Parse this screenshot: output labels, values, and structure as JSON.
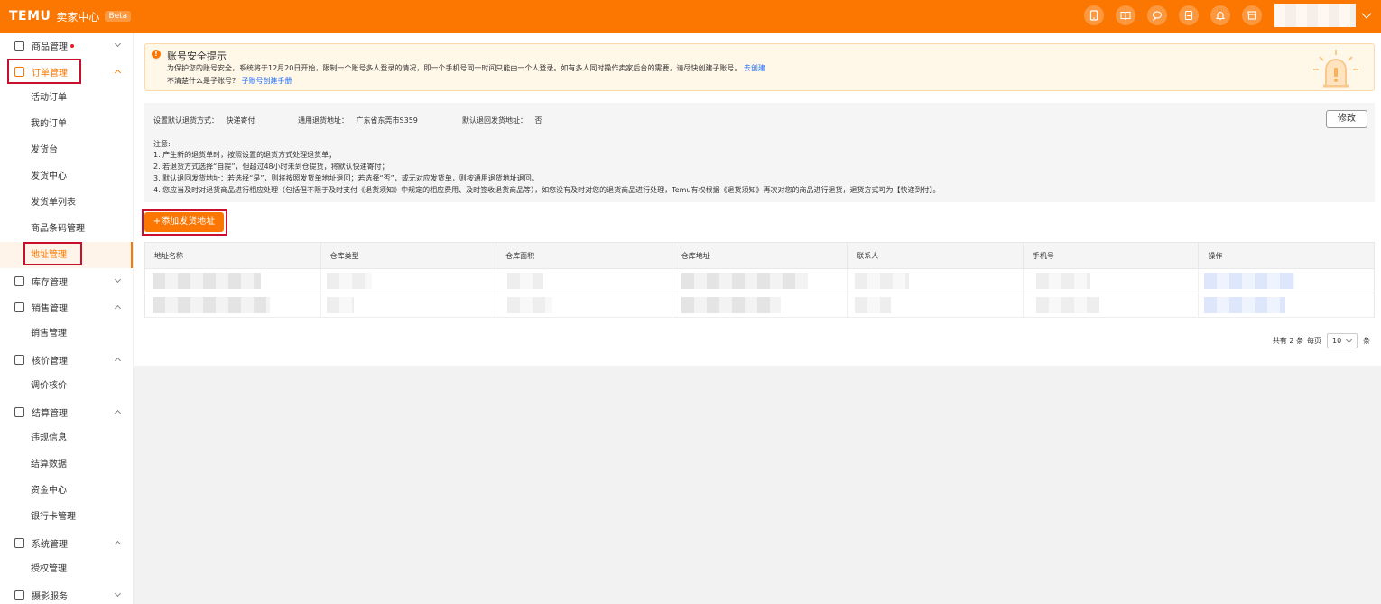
{
  "header": {
    "logo": "TEMU",
    "title": "卖家中心",
    "badge": "Beta",
    "icons": [
      "tablet-icon",
      "book-icon",
      "chat-icon",
      "document-icon",
      "bell-icon",
      "store-icon"
    ]
  },
  "sidebar": {
    "groups": [
      {
        "label": "商品管理",
        "icon": "product-icon",
        "expanded": false,
        "has_dot": true,
        "items": []
      },
      {
        "label": "订单管理",
        "icon": "order-icon",
        "expanded": true,
        "active": true,
        "items": [
          "活动订单",
          "我的订单",
          "发货台",
          "发货中心",
          "发货单列表",
          "商品条码管理",
          "地址管理"
        ]
      },
      {
        "label": "库存管理",
        "icon": "warehouse-icon",
        "expanded": false,
        "items": []
      },
      {
        "label": "销售管理",
        "icon": "sales-chart-icon",
        "expanded": true,
        "items": [
          "销售管理"
        ]
      },
      {
        "label": "核价管理",
        "icon": "price-icon",
        "expanded": true,
        "items": [
          "调价核价"
        ]
      },
      {
        "label": "结算管理",
        "icon": "settlement-icon",
        "expanded": true,
        "items": [
          "违规信息",
          "结算数据",
          "资金中心",
          "银行卡管理"
        ]
      },
      {
        "label": "系统管理",
        "icon": "shield-icon",
        "expanded": true,
        "items": [
          "授权管理"
        ]
      },
      {
        "label": "摄影服务",
        "icon": "camera-icon",
        "expanded": false,
        "items": []
      }
    ],
    "selected_item": "地址管理"
  },
  "alert": {
    "title": "账号安全提示",
    "line1": "为保护您的账号安全，系统将于12月20日开始，限制一个账号多人登录的情况，即一个手机号同一时间只能由一个人登录。如有多人同时操作卖家后台的需要，请尽快创建子账号。",
    "line1_link": "去创建",
    "line2": "不清楚什么是子账号？",
    "line2_link": "子账号创建手册"
  },
  "info": {
    "return_method_label": "设置默认退货方式：",
    "return_method_value": "快递寄付",
    "return_address_label": "通用退货地址：",
    "return_address_value": "广东省东莞市S359",
    "default_ship_label": "默认退回发货地址：",
    "default_ship_value": "否",
    "edit_button": "修改",
    "notes_title": "注意:",
    "notes": [
      "1. 产生新的退货单时，按照设置的退货方式处理退货单；",
      "2. 若退货方式选择“自提”，但超过48小时未到仓提货，将默认快递寄付；",
      "3. 默认退回发货地址：若选择“是”，则将按照发货单地址退回；若选择“否”，或无对应发货单，则按通用退货地址退回。",
      "4. 您应当及时对退货商品进行相应处理（包括但不限于及时支付《退货须知》中规定的相应费用、及时签收退货商品等），如您没有及时对您的退货商品进行处理，Temu有权根据《退货须知》再次对您的商品进行退货，退货方式可为【快递到付】。"
    ]
  },
  "add_button": "+添加发货地址",
  "table": {
    "columns": [
      "地址名称",
      "仓库类型",
      "仓库面积",
      "仓库地址",
      "联系人",
      "手机号",
      "操作"
    ]
  },
  "pager": {
    "total_text": "共有 2 条",
    "per_page_label": "每页",
    "per_page_value": "10",
    "unit": "条"
  },
  "colors": {
    "brand": "#fb7701",
    "highlight_box": "#c8102e",
    "link": "#1e6fff"
  }
}
